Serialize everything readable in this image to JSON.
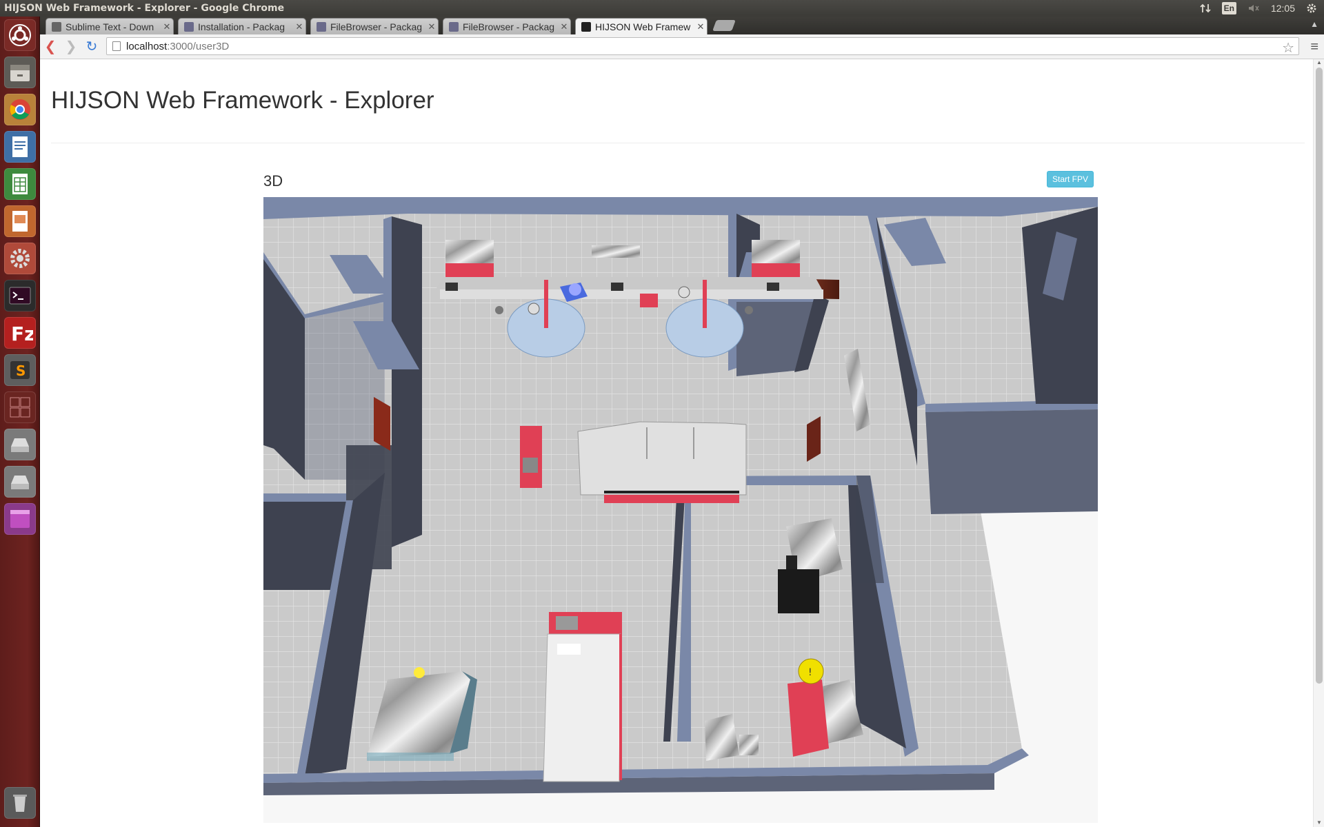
{
  "system": {
    "window_title": "HIJSON Web Framework - Explorer - Google Chrome",
    "language": "En",
    "clock": "12:05"
  },
  "launcher": {
    "items": [
      "ubuntu-dash",
      "files",
      "chrome",
      "writer",
      "calc",
      "impress",
      "settings",
      "terminal",
      "filezilla",
      "sublime-text",
      "workspaces",
      "drive-1",
      "drive-2",
      "app",
      "trash"
    ]
  },
  "tabs": [
    {
      "label": "Sublime Text - Down",
      "active": false
    },
    {
      "label": "Installation - Packag",
      "active": false
    },
    {
      "label": "FileBrowser - Packag",
      "active": false
    },
    {
      "label": "FileBrowser - Packag",
      "active": false
    },
    {
      "label": "HIJSON Web Framew",
      "active": true
    }
  ],
  "address": {
    "host": "localhost",
    "path": ":3000/user3D"
  },
  "page": {
    "title": "HIJSON Web Framework - Explorer",
    "panel_label": "3D",
    "fpv_button": "Start FPV"
  },
  "colors": {
    "launcher": "#6d2320",
    "accent_button": "#5bc0de",
    "wall_top": "#7a88a8",
    "wall_side": "#3e4250",
    "floor": "#c9c9c9",
    "furniture_red": "#e04055"
  }
}
